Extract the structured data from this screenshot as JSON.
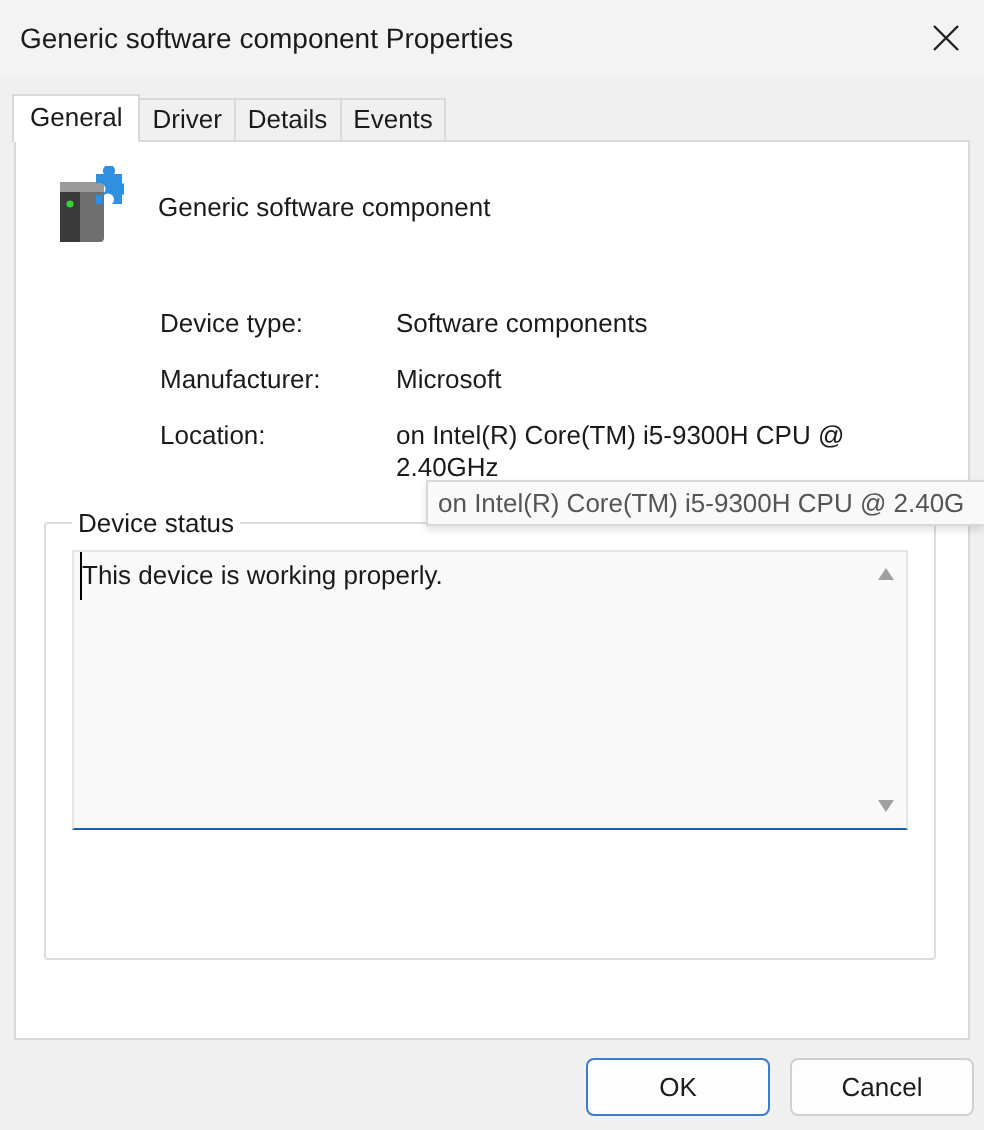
{
  "window": {
    "title": "Generic software component Properties"
  },
  "tabs": [
    {
      "label": "General",
      "selected": true
    },
    {
      "label": "Driver",
      "selected": false
    },
    {
      "label": "Details",
      "selected": false
    },
    {
      "label": "Events",
      "selected": false
    }
  ],
  "device": {
    "name": "Generic software component"
  },
  "properties": [
    {
      "label": "Device type:",
      "value": "Software components"
    },
    {
      "label": "Manufacturer:",
      "value": "Microsoft"
    },
    {
      "label": "Location:",
      "value": "on Intel(R) Core(TM) i5-9300H CPU @ 2.40GHz"
    }
  ],
  "tooltip": {
    "text": "on Intel(R) Core(TM) i5-9300H CPU @ 2.40G"
  },
  "device_status": {
    "label": "Device status",
    "text": "This device is working properly."
  },
  "buttons": [
    {
      "label": "OK",
      "default": true
    },
    {
      "label": "Cancel",
      "default": false
    }
  ]
}
